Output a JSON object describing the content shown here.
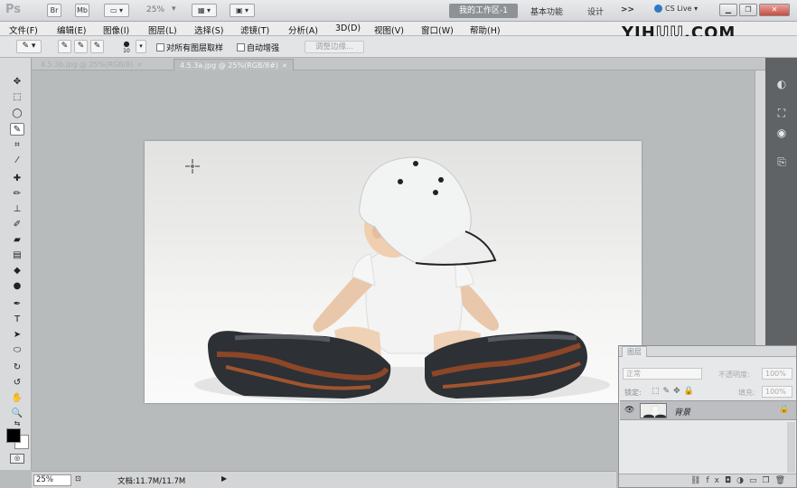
{
  "app": {
    "logo": "Ps"
  },
  "titlebar": {
    "br_label": "Br",
    "mb_label": "Mb",
    "zoom": "25%",
    "workspace_active": "我的工作区-1",
    "workspace_basic": "基本功能",
    "workspace_design": "设计",
    "more": ">>",
    "cslive": "CS Live"
  },
  "menu": [
    {
      "label": "文件(F)"
    },
    {
      "label": "编辑(E)"
    },
    {
      "label": "图像(I)"
    },
    {
      "label": "图层(L)"
    },
    {
      "label": "选择(S)"
    },
    {
      "label": "滤镜(T)"
    },
    {
      "label": "分析(A)"
    },
    {
      "label": "3D(D)"
    },
    {
      "label": "视图(V)"
    },
    {
      "label": "窗口(W)"
    },
    {
      "label": "帮助(H)"
    }
  ],
  "watermark": {
    "prefix": "YIH",
    "mid": "UU",
    "suffix": ".COM"
  },
  "options": {
    "brush_size": "10",
    "sample_all_layers": "对所有图层取样",
    "auto_enhance": "自动增强",
    "refine_edge": "调整边缘..."
  },
  "tabs": [
    {
      "label": "4.5.3b.jpg @ 25%(RGB/8)"
    },
    {
      "label": "4.5.3a.jpg @ 25%(RGB/8#)"
    }
  ],
  "status": {
    "zoom": "25%",
    "doc": "文档:11.7M/11.7M"
  },
  "layers_panel": {
    "title": "图层",
    "blend_mode": "正常",
    "opacity_label": "不透明度:",
    "opacity_value": "100%",
    "lock_label": "锁定:",
    "fill_label": "填充:",
    "fill_value": "100%",
    "layer_name": "背景"
  }
}
